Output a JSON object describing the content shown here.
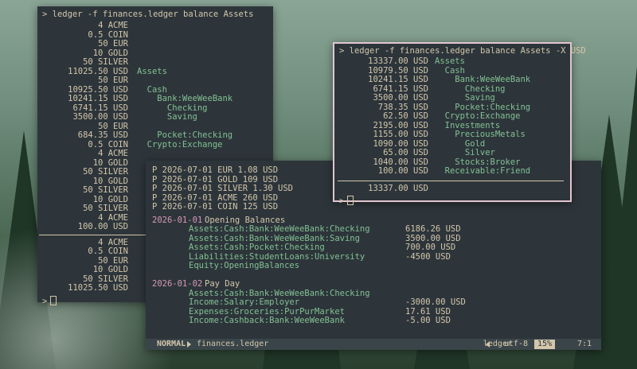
{
  "left_terminal": {
    "prompt": "> ledger -f finances.ledger balance Assets",
    "rows": [
      {
        "amount": "4 ACME",
        "account": ""
      },
      {
        "amount": "0.5 COIN",
        "account": ""
      },
      {
        "amount": "50 EUR",
        "account": ""
      },
      {
        "amount": "10 GOLD",
        "account": ""
      },
      {
        "amount": "50 SILVER",
        "account": ""
      },
      {
        "amount": "11025.50 USD",
        "account": "Assets"
      },
      {
        "amount": "50 EUR",
        "account": ""
      },
      {
        "amount": "10925.50 USD",
        "account": "  Cash"
      },
      {
        "amount": "10241.15 USD",
        "account": "    Bank:WeeWeeBank"
      },
      {
        "amount": "6741.15 USD",
        "account": "      Checking"
      },
      {
        "amount": "3500.00 USD",
        "account": "      Saving"
      },
      {
        "amount": "50 EUR",
        "account": ""
      },
      {
        "amount": "684.35 USD",
        "account": "    Pocket:Checking"
      },
      {
        "amount": "0.5 COIN",
        "account": "  Crypto:Exchange"
      },
      {
        "amount": "4 ACME",
        "account": ""
      },
      {
        "amount": "10 GOLD",
        "account": ""
      },
      {
        "amount": "50 SILVER",
        "account": "  I"
      },
      {
        "amount": "10 GOLD",
        "account": ""
      },
      {
        "amount": "50 SILVER",
        "account": ""
      },
      {
        "amount": "10 GOLD",
        "account": ""
      },
      {
        "amount": "50 SILVER",
        "account": ""
      },
      {
        "amount": "4 ACME",
        "account": ""
      },
      {
        "amount": "100.00 USD",
        "account": "  Re"
      }
    ],
    "totals": [
      "4 ACME",
      "0.5 COIN",
      "50 EUR",
      "10 GOLD",
      "50 SILVER",
      "11025.50 USD"
    ],
    "prompt_end": ">"
  },
  "right_terminal": {
    "prompt": "> ledger -f finances.ledger balance Assets -X USD",
    "rows": [
      {
        "amount": "13337.00 USD",
        "account": "Assets"
      },
      {
        "amount": "10979.50 USD",
        "account": "  Cash"
      },
      {
        "amount": "10241.15 USD",
        "account": "    Bank:WeeWeeBank"
      },
      {
        "amount": "6741.15 USD",
        "account": "      Checking"
      },
      {
        "amount": "3500.00 USD",
        "account": "      Saving"
      },
      {
        "amount": "738.35 USD",
        "account": "    Pocket:Checking"
      },
      {
        "amount": "62.50 USD",
        "account": "  Crypto:Exchange"
      },
      {
        "amount": "2195.00 USD",
        "account": "  Investments"
      },
      {
        "amount": "1155.00 USD",
        "account": "    PreciousMetals"
      },
      {
        "amount": "1090.00 USD",
        "account": "      Gold"
      },
      {
        "amount": "65.00 USD",
        "account": "      Silver"
      },
      {
        "amount": "1040.00 USD",
        "account": "    Stocks:Broker"
      },
      {
        "amount": "100.00 USD",
        "account": "  Receivable:Friend"
      }
    ],
    "total": "13337.00 USD",
    "prompt_end": ">"
  },
  "editor": {
    "prices": [
      "P 2026-07-01 EUR 1.08 USD",
      "P 2026-07-01 GOLD 109 USD",
      "P 2026-07-01 SILVER 1.30 USD",
      "P 2026-07-01 ACME 260 USD",
      "P 2026-07-01 COIN 125 USD"
    ],
    "tx1": {
      "date": "2026-01-01",
      "desc": "Opening Balances",
      "postings": [
        {
          "account": "Assets:Cash:Bank:WeeWeeBank:Checking",
          "amount": "6186.26 USD"
        },
        {
          "account": "Assets:Cash:Bank:WeeWeeBank:Saving",
          "amount": "3500.00 USD"
        },
        {
          "account": "Assets:Cash:Pocket:Checking",
          "amount": "700.00 USD"
        },
        {
          "account": "Liabilities:StudentLoans:University",
          "amount": "-4500 USD"
        },
        {
          "account": "Equity:OpeningBalances",
          "amount": ""
        }
      ]
    },
    "tx2": {
      "date": "2026-01-02",
      "desc": "Pay Day",
      "postings": [
        {
          "account": "Assets:Cash:Bank:WeeWeeBank:Checking",
          "amount": ""
        },
        {
          "account": "Income:Salary:Employer",
          "amount": "-3000.00 USD"
        },
        {
          "account": "Expenses:Groceries:PurPurMarket",
          "amount": "17.61 USD"
        },
        {
          "account": "Income:Cashback:Bank:WeeWeeBank",
          "amount": "-5.00 USD"
        }
      ]
    },
    "status": {
      "mode": "NORMAL",
      "filename": "finances.ledger",
      "filetype": "ledger",
      "encoding": "utf-8",
      "percent": "15%",
      "position": "7:1"
    }
  }
}
